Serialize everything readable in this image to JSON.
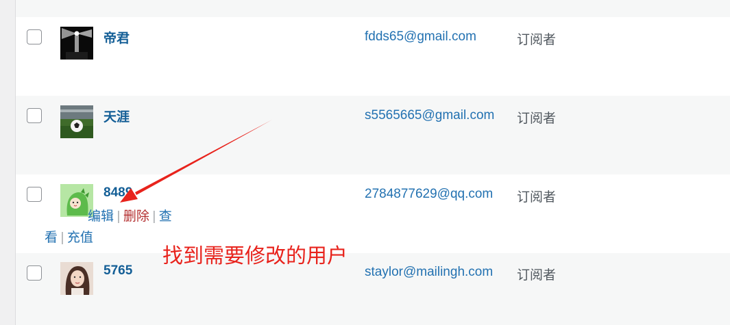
{
  "users": [
    {
      "username": "帝君",
      "email": "fdds65@gmail.com",
      "role": "订阅者",
      "avatar": "lighthouse-avatar"
    },
    {
      "username": "天涯",
      "email": "s5565665@gmail.com",
      "role": "订阅者",
      "avatar": "soccer-ball-avatar"
    },
    {
      "username": "8489",
      "email": "2784877629@qq.com",
      "role": "订阅者",
      "avatar": "green-dinosaur-avatar"
    },
    {
      "username": "5765",
      "email": "staylor@mailingh.com",
      "role": "订阅者",
      "avatar": "portrait-avatar"
    }
  ],
  "row_actions": {
    "edit": "编辑",
    "delete": "删除",
    "view_part1": "查",
    "view_part2": "看",
    "recharge": "充值",
    "separator": "|"
  },
  "annotation": {
    "text": "找到需要修改的用户",
    "color": "#e8231c"
  },
  "colors": {
    "link": "#2271b1",
    "username": "#135e96",
    "delete": "#b32d2e",
    "role_text": "#50575e",
    "row_alt": "#f6f7f7"
  }
}
